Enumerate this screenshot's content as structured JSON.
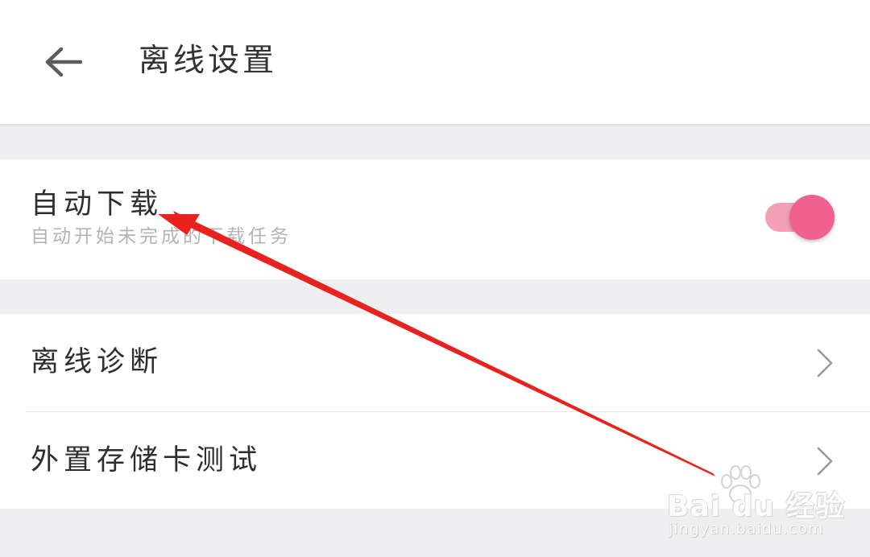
{
  "header": {
    "back_icon": "arrow-left-icon",
    "title": "离线设置"
  },
  "auto_download": {
    "title": "自动下载",
    "subtitle": "自动开始未完成的下载任务",
    "toggle_on": true,
    "toggle_track_color": "#f3a0b5",
    "toggle_thumb_color": "#f0618f"
  },
  "list": {
    "items": [
      {
        "label": "离线诊断",
        "icon": "chevron-right-icon"
      },
      {
        "label": "外置存储卡测试",
        "icon": "chevron-right-icon"
      }
    ]
  },
  "annotation": {
    "arrow_color": "#e8231f"
  },
  "watermark": {
    "brand": "Bai  du 经验",
    "url": "jingyan.baidu.com"
  },
  "colors": {
    "background": "#efeff1",
    "surface": "#ffffff",
    "text_primary": "#2e2e2e",
    "text_secondary": "#b3b3b3"
  }
}
